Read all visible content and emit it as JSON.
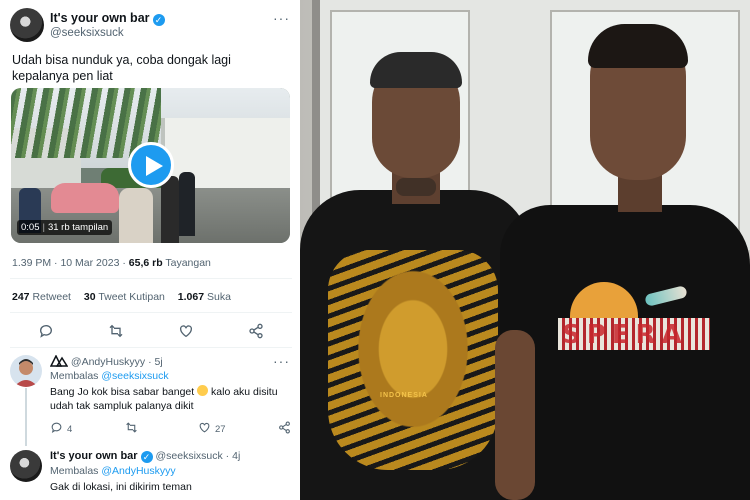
{
  "tweet": {
    "author_name": "It's your own bar",
    "author_handle": "@seeksixsuck",
    "text": "Udah bisa nunduk ya, coba dongak lagi kepalanya pen liat",
    "video": {
      "time": "0:05",
      "views": "31 rb tampilan"
    },
    "time": "1.39 PM",
    "date": "10 Mar 2023",
    "views_count": "65,6 rb",
    "views_label": "Tayangan",
    "stats": {
      "retweets_count": "247",
      "retweets_label": "Retweet",
      "quotes_count": "30",
      "quotes_label": "Tweet Kutipan",
      "likes_count": "1.067",
      "likes_label": "Suka"
    }
  },
  "replies": [
    {
      "author_handle": "@AndyHuskyyy",
      "time": "5j",
      "replying_prefix": "Membalas",
      "replying_to": "@seeksixsuck",
      "text_before_emoji": "Bang Jo kok bisa sabar banget",
      "text_after_emoji": "kalo aku disitu udah tak sampluk palanya dikit",
      "emoji": "flushed-emoji",
      "reply_count": "4",
      "like_count": "27"
    },
    {
      "author_name": "It's your own bar",
      "author_handle": "@seeksixsuck",
      "time": "4j",
      "replying_prefix": "Membalas",
      "replying_to": "@AndyHuskyyy",
      "text": "Gak di lokasi, ini dikirim teman"
    }
  ],
  "photo": {
    "shirt_left_print_1": "INDONESIA",
    "shirt_right_print": "SPERA"
  },
  "colors": {
    "twitter_blue": "#1d9bf0",
    "text_secondary": "#536471"
  }
}
